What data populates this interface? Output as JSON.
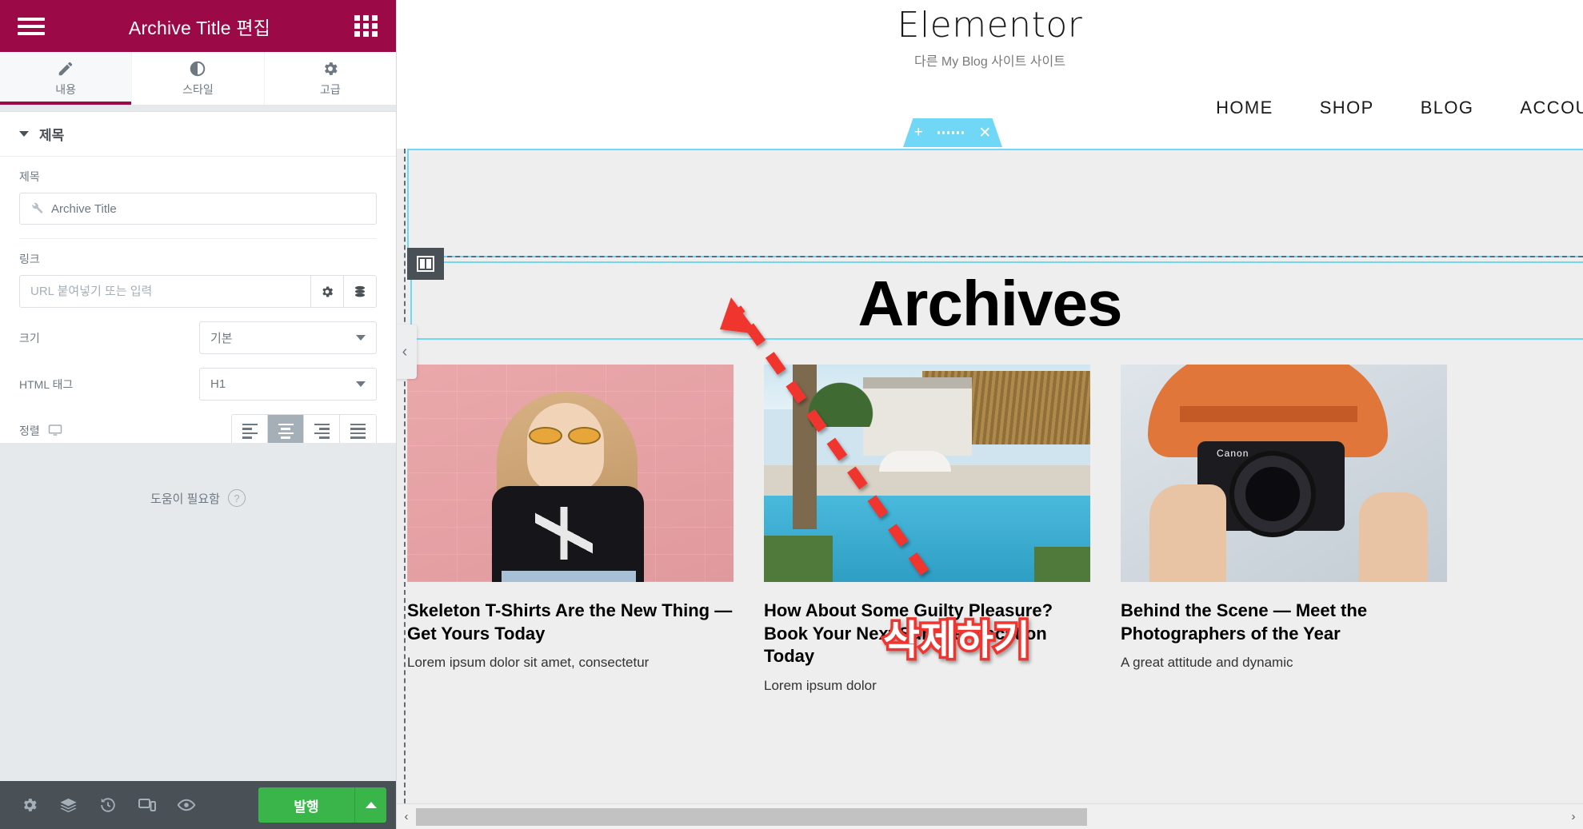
{
  "panel": {
    "header": {
      "title": "Archive Title 편집",
      "menu_icon": "hamburger-icon",
      "widgets_icon": "grid-apps-icon"
    },
    "tabs": [
      {
        "label": "내용",
        "icon": "pencil-icon",
        "active": true
      },
      {
        "label": "스타일",
        "icon": "contrast-circle-icon",
        "active": false
      },
      {
        "label": "고급",
        "icon": "gear-icon",
        "active": false
      }
    ],
    "accordion": {
      "title": "제목",
      "caret": "caret-down-icon"
    },
    "fields": {
      "title_label": "제목",
      "title_value": "Archive Title",
      "title_icon": "wrench-icon",
      "link_label": "링크",
      "link_placeholder": "URL 붙여넣기 또는 입력",
      "link_value": "",
      "link_options_icon": "gear-icon",
      "link_dynamic_icon": "database-stack-icon",
      "size_label": "크기",
      "size_value": "기본",
      "html_tag_label": "HTML 태그",
      "html_tag_value": "H1",
      "align_label": "정렬",
      "align_device_icon": "desktop-icon",
      "align_options": [
        "left",
        "center",
        "right",
        "justify"
      ],
      "align_selected": "center"
    },
    "need_help": {
      "label": "도움이 필요함",
      "icon": "question-circle-icon"
    },
    "footer": {
      "icons": [
        "gear-icon",
        "layers-icon",
        "history-icon",
        "responsive-icon",
        "eye-preview-icon"
      ],
      "publish_label": "발행",
      "publish_arrow_icon": "caret-up-icon"
    }
  },
  "preview": {
    "site": {
      "title": "Elementor",
      "tagline": "다른 My Blog 사이트 사이트",
      "nav": [
        "HOME",
        "SHOP",
        "BLOG",
        "ACCOUNT"
      ]
    },
    "section_toolbar": {
      "add_icon": "plus-icon",
      "drag_icon": "dots-grid-icon",
      "close_icon": "x-close-icon"
    },
    "column_handle_icon": "columns-icon",
    "collapse_icon": "chevron-left-icon",
    "heading": "Archives",
    "posts": [
      {
        "title": "Skeleton T-Shirts Are the New Thing — Get Yours Today",
        "excerpt": "Lorem ipsum dolor sit amet, consectetur",
        "thumb": "woman-pink-wall-skeleton-tshirt"
      },
      {
        "title": "How About Some Guilty Pleasure? Book Your Next Summer Vacation Today",
        "excerpt": "Lorem ipsum dolor",
        "thumb": "tropical-pool-resort"
      },
      {
        "title": "Behind the Scene — Meet the Photographers of the Year",
        "excerpt": "A great attitude and dynamic",
        "thumb": "photographer-with-hat-camera"
      }
    ],
    "annotation": {
      "text": "삭제하기",
      "arrow": "red-dashed-arrow-up-right"
    },
    "scrollbar": {
      "left_arrow": "‹",
      "right_arrow": "›"
    }
  },
  "colors": {
    "panel_header": "#9b0a46",
    "publish_green": "#39b54a",
    "section_blue": "#71d7f7",
    "footer_dark": "#495157",
    "annotation_red": "#f0342f"
  }
}
